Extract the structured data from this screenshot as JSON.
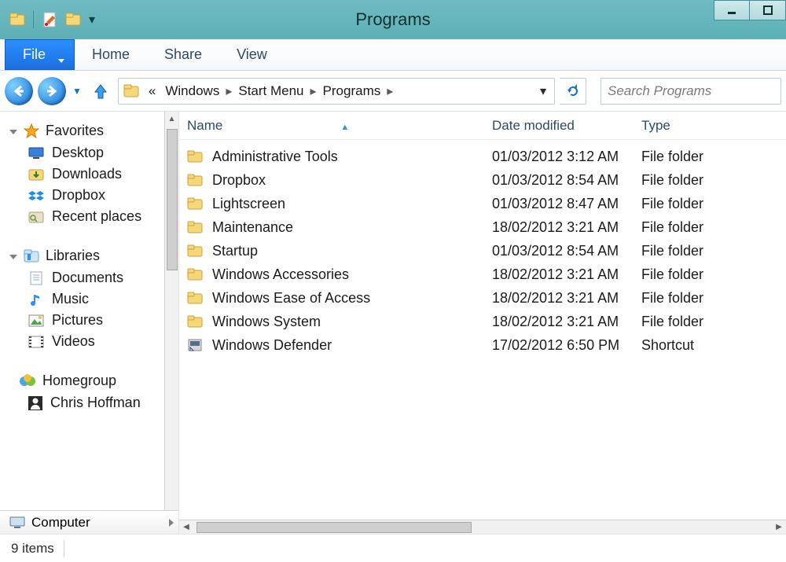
{
  "window_title": "Programs",
  "ribbon": {
    "file": "File",
    "tabs": [
      "Home",
      "Share",
      "View"
    ]
  },
  "breadcrumbs": [
    "Windows",
    "Start Menu",
    "Programs"
  ],
  "search_placeholder": "Search Programs",
  "columns": {
    "name": "Name",
    "date": "Date modified",
    "type": "Type"
  },
  "sidebar": {
    "favorites": {
      "label": "Favorites",
      "items": [
        {
          "icon": "desktop",
          "label": "Desktop"
        },
        {
          "icon": "downloads",
          "label": "Downloads"
        },
        {
          "icon": "dropbox",
          "label": "Dropbox"
        },
        {
          "icon": "recent",
          "label": "Recent places"
        }
      ]
    },
    "libraries": {
      "label": "Libraries",
      "items": [
        {
          "icon": "doc",
          "label": "Documents"
        },
        {
          "icon": "music",
          "label": "Music"
        },
        {
          "icon": "pic",
          "label": "Pictures"
        },
        {
          "icon": "video",
          "label": "Videos"
        }
      ]
    },
    "homegroup": {
      "label": "Homegroup",
      "user": "Chris Hoffman"
    },
    "computer": "Computer"
  },
  "files": [
    {
      "icon": "folder",
      "name": "Administrative Tools",
      "date": "01/03/2012 3:12 AM",
      "type": "File folder"
    },
    {
      "icon": "folder",
      "name": "Dropbox",
      "date": "01/03/2012 8:54 AM",
      "type": "File folder"
    },
    {
      "icon": "folder",
      "name": "Lightscreen",
      "date": "01/03/2012 8:47 AM",
      "type": "File folder"
    },
    {
      "icon": "folder",
      "name": "Maintenance",
      "date": "18/02/2012 3:21 AM",
      "type": "File folder"
    },
    {
      "icon": "folder",
      "name": "Startup",
      "date": "01/03/2012 8:54 AM",
      "type": "File folder"
    },
    {
      "icon": "folder",
      "name": "Windows Accessories",
      "date": "18/02/2012 3:21 AM",
      "type": "File folder"
    },
    {
      "icon": "folder",
      "name": "Windows Ease of Access",
      "date": "18/02/2012 3:21 AM",
      "type": "File folder"
    },
    {
      "icon": "folder",
      "name": "Windows System",
      "date": "18/02/2012 3:21 AM",
      "type": "File folder"
    },
    {
      "icon": "shortcut",
      "name": "Windows Defender",
      "date": "17/02/2012 6:50 PM",
      "type": "Shortcut"
    }
  ],
  "status": "9 items"
}
